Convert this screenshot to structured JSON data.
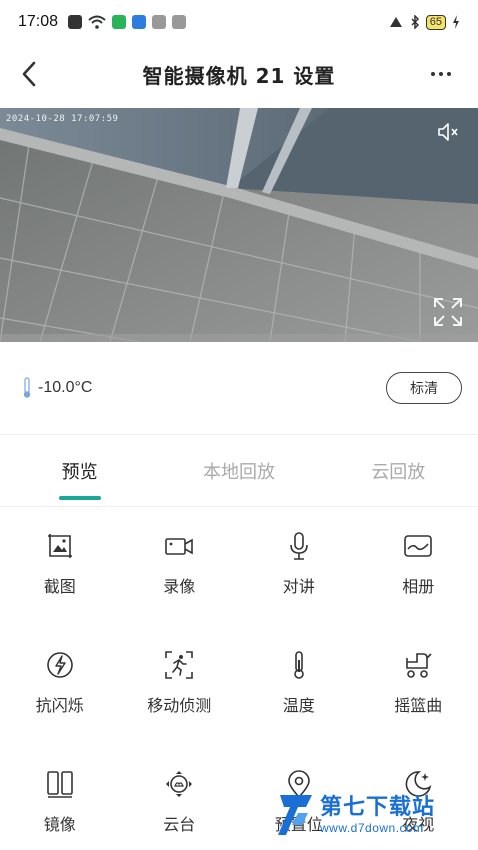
{
  "status_bar": {
    "time": "17:08",
    "battery": "65"
  },
  "header": {
    "title": "智能摄像机 21 设置"
  },
  "video": {
    "timestamp": "2024-10-28 17:07:59"
  },
  "info": {
    "temperature": "-10.0°C",
    "quality_label": "标清"
  },
  "tabs": [
    {
      "label": "预览",
      "active": true
    },
    {
      "label": "本地回放",
      "active": false
    },
    {
      "label": "云回放",
      "active": false
    }
  ],
  "functions": [
    {
      "label": "截图",
      "icon": "screenshot-icon"
    },
    {
      "label": "录像",
      "icon": "video-record-icon"
    },
    {
      "label": "对讲",
      "icon": "microphone-icon"
    },
    {
      "label": "相册",
      "icon": "album-icon"
    },
    {
      "label": "抗闪烁",
      "icon": "anti-flicker-icon"
    },
    {
      "label": "移动侦测",
      "icon": "motion-detect-icon"
    },
    {
      "label": "温度",
      "icon": "thermometer-icon"
    },
    {
      "label": "摇篮曲",
      "icon": "lullaby-stroller-icon"
    },
    {
      "label": "镜像",
      "icon": "mirror-icon"
    },
    {
      "label": "云台",
      "icon": "ptz-icon"
    },
    {
      "label": "预置位",
      "icon": "location-pin-icon"
    },
    {
      "label": "夜视",
      "icon": "night-vision-icon"
    }
  ],
  "watermark": {
    "title": "第七下载站",
    "url": "www.d7down.com"
  },
  "colors": {
    "accent": "#1aa89a",
    "watermark": "#1a6fd6"
  }
}
